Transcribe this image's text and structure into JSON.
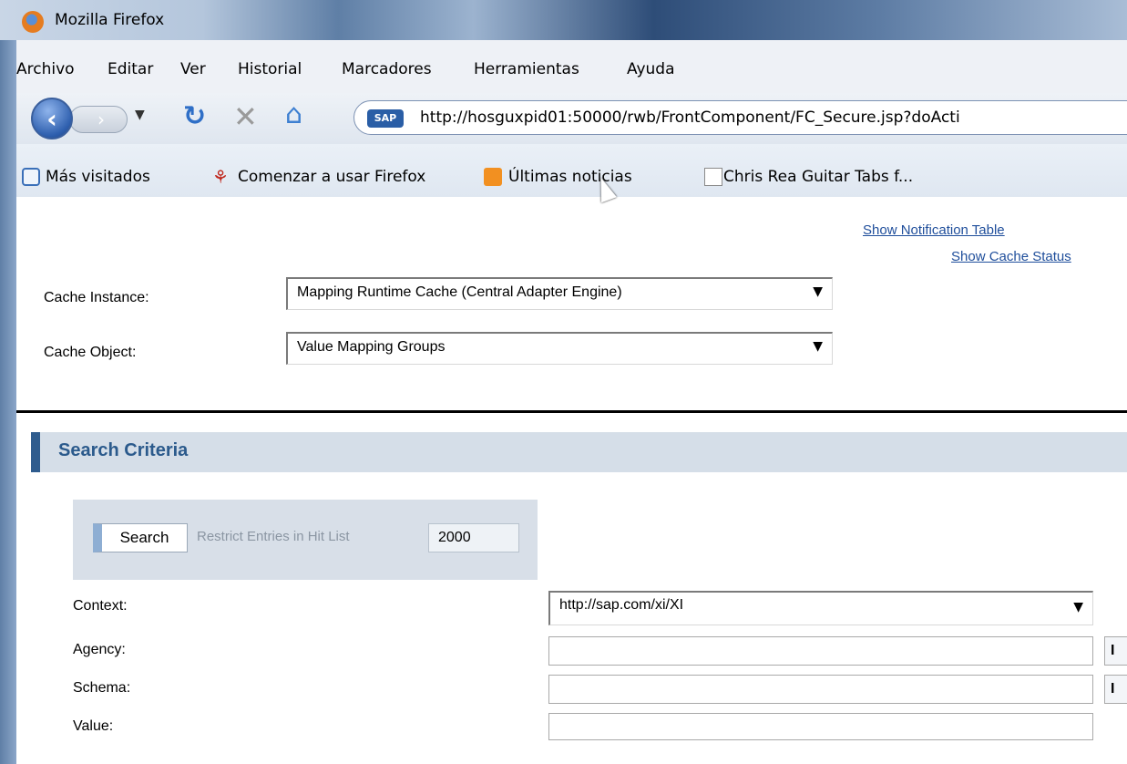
{
  "window": {
    "title": "Mozilla Firefox"
  },
  "menubar": {
    "items": [
      "Archivo",
      "Editar",
      "Ver",
      "Historial",
      "Marcadores",
      "Herramientas",
      "Ayuda"
    ]
  },
  "navbar": {
    "site_badge": "SAP",
    "url": "http://hosguxpid01:50000/rwb/FrontComponent/FC_Secure.jsp?doActi"
  },
  "bookmarks": {
    "items": [
      "Más visitados",
      "Comenzar a usar Firefox",
      "Últimas noticias",
      "Chris Rea Guitar Tabs f..."
    ]
  },
  "page": {
    "links": {
      "notification_table": "Show Notification Table",
      "cache_status": "Show Cache Status"
    },
    "cache_instance": {
      "label": "Cache Instance:",
      "value": "Mapping Runtime Cache (Central Adapter Engine)"
    },
    "cache_object": {
      "label": "Cache Object:",
      "value": "Value Mapping Groups"
    },
    "section_title": "Search Criteria",
    "search": {
      "button": "Search",
      "restrict_label": "Restrict Entries in Hit List",
      "hit_limit": "2000"
    },
    "fields": {
      "context_label": "Context:",
      "context_value": "http://sap.com/xi/XI",
      "agency_label": "Agency:",
      "schema_label": "Schema:",
      "value_label": "Value:",
      "side_button_text": "I"
    }
  }
}
